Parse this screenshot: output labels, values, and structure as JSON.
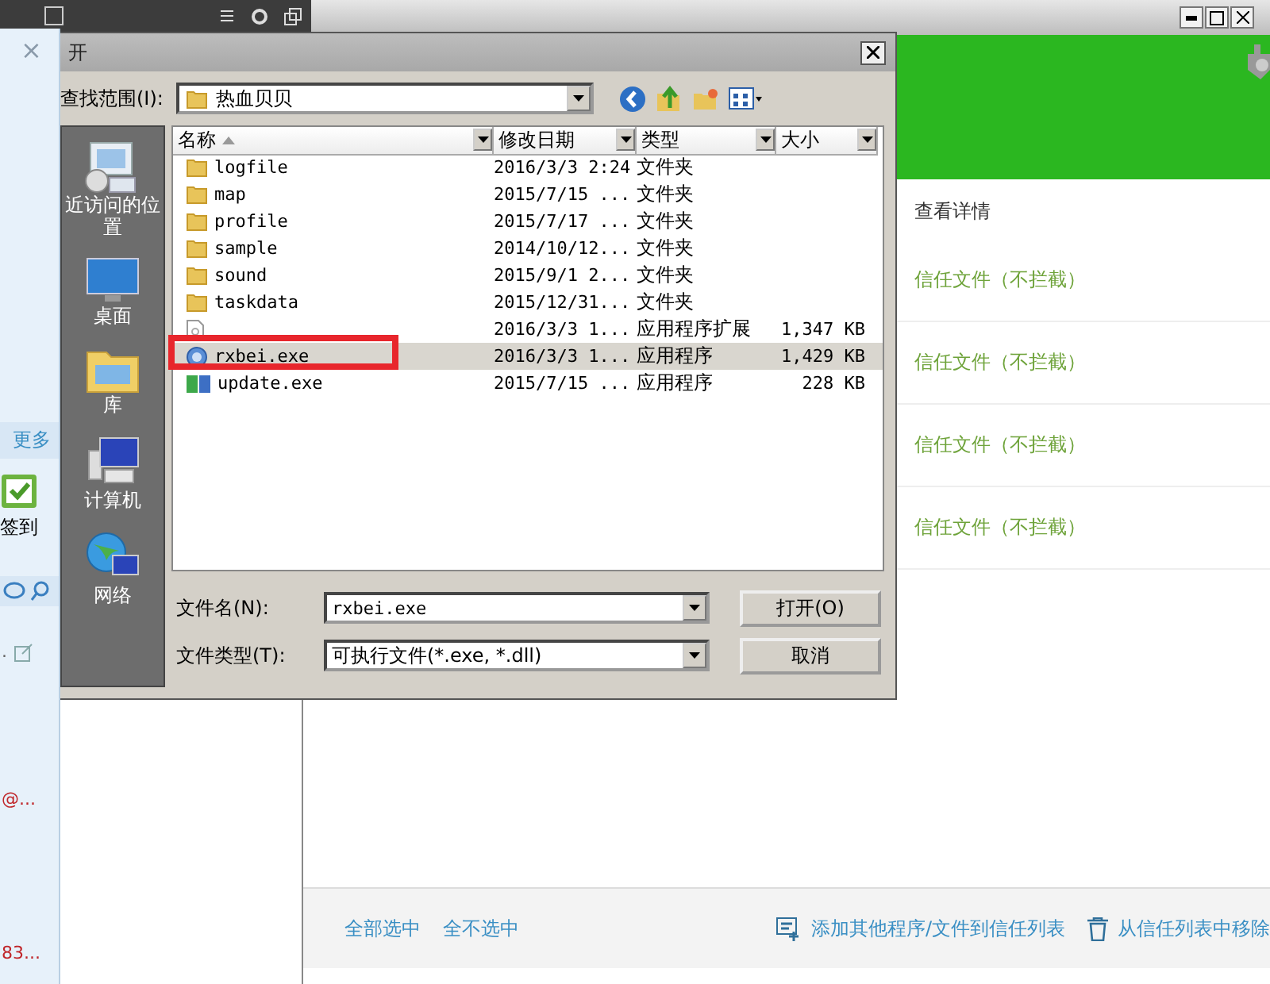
{
  "side_panel": {
    "close_glyph": "×",
    "more_link": "更多",
    "checkin": {
      "label": "签到",
      "checked": true
    },
    "entries": [
      {
        "text": ".",
        "kind": "note"
      },
      {
        "text": "@...",
        "kind": "alert"
      },
      {
        "text": "83...",
        "kind": "alert"
      }
    ]
  },
  "background_app": {
    "details_label": "查看详情",
    "rows": [
      {
        "status": "信任文件（不拦截）"
      },
      {
        "status": "信任文件（不拦截）"
      },
      {
        "status": "信任文件（不拦截）"
      },
      {
        "status": "信任文件（不拦截）"
      }
    ],
    "footer": {
      "links": [
        "全部选中",
        "全不选中"
      ],
      "actions": [
        {
          "kind": "add",
          "label": "添加其他程序/文件到信任列表"
        },
        {
          "kind": "remove",
          "label": "从信任列表中移除"
        }
      ]
    }
  },
  "dialog": {
    "title": "开",
    "look_in_label": "查找范围(I):",
    "location": "热血贝贝",
    "places": [
      {
        "label": "近访问的位置",
        "kind": "recent"
      },
      {
        "label": "桌面",
        "kind": "desktop"
      },
      {
        "label": "库",
        "kind": "library"
      },
      {
        "label": "计算机",
        "kind": "computer"
      },
      {
        "label": "网络",
        "kind": "network"
      }
    ],
    "columns": [
      {
        "label": "名称",
        "sorted": true
      },
      {
        "label": "修改日期",
        "sorted": false
      },
      {
        "label": "类型",
        "sorted": false
      },
      {
        "label": "大小",
        "sorted": false
      }
    ],
    "files": [
      {
        "kind": "folder",
        "name": "logfile",
        "modified": "2016/3/3 2:24",
        "type": "文件夹",
        "selected": false,
        "highlighted": false
      },
      {
        "kind": "folder",
        "name": "map",
        "modified": "2015/7/15 ...",
        "type": "文件夹",
        "selected": false,
        "highlighted": false
      },
      {
        "kind": "folder",
        "name": "profile",
        "modified": "2015/7/17 ...",
        "type": "文件夹",
        "selected": false,
        "highlighted": false
      },
      {
        "kind": "folder",
        "name": "sample",
        "modified": "2014/10/12...",
        "type": "文件夹",
        "selected": false,
        "highlighted": false
      },
      {
        "kind": "folder",
        "name": "sound",
        "modified": "2015/9/1 2...",
        "type": "文件夹",
        "selected": false,
        "highlighted": false
      },
      {
        "kind": "folder",
        "name": "taskdata",
        "modified": "2015/12/31...",
        "type": "文件夹",
        "selected": false,
        "highlighted": false
      },
      {
        "kind": "dll",
        "modified": "2016/3/3 1...",
        "type": "应用程序扩展",
        "size": "1,347 KB",
        "selected": false,
        "highlighted": false
      },
      {
        "kind": "app",
        "name": "rxbei.exe",
        "modified": "2016/3/3 1...",
        "type": "应用程序",
        "size": "1,429 KB",
        "selected": true,
        "highlighted": true
      },
      {
        "kind": "setup",
        "name": "update.exe",
        "modified": "2015/7/15 ...",
        "type": "应用程序",
        "size": "228 KB",
        "selected": false,
        "highlighted": false
      }
    ],
    "file_name_label": "文件名(N):",
    "file_name": "rxbei.exe",
    "file_type_label": "文件类型(T):",
    "file_type": "可执行文件(*.exe, *.dll)",
    "buttons": [
      "打开(O)",
      "取消"
    ]
  }
}
